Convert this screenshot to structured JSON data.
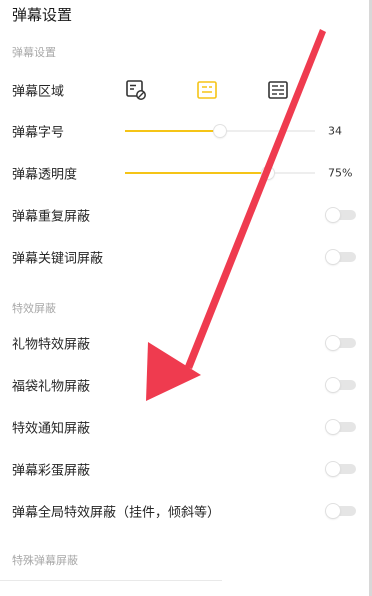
{
  "header": {
    "title": "弹幕设置"
  },
  "section_danmaku": {
    "label": "弹幕设置"
  },
  "area": {
    "label": "弹幕区域",
    "options": [
      {
        "icon": "screen-area-disabled-icon",
        "selected": false
      },
      {
        "icon": "half-screen-area-icon",
        "selected": true
      },
      {
        "icon": "full-screen-area-icon",
        "selected": false
      }
    ],
    "accent": "#f5c417"
  },
  "font_size": {
    "label": "弹幕字号",
    "value": "34",
    "fraction": 0.5
  },
  "opacity": {
    "label": "弹幕透明度",
    "value": "75%",
    "fraction": 0.75
  },
  "toggles_main": [
    {
      "label": "弹幕重复屏蔽",
      "on": false
    },
    {
      "label": "弹幕关键词屏蔽",
      "on": false
    }
  ],
  "section_effects": {
    "label": "特效屏蔽"
  },
  "toggles_effects": [
    {
      "label": "礼物特效屏蔽",
      "on": false
    },
    {
      "label": "福袋礼物屏蔽",
      "on": false
    },
    {
      "label": "特效通知屏蔽",
      "on": false
    },
    {
      "label": "弹幕彩蛋屏蔽",
      "on": false
    },
    {
      "label": "弹幕全局特效屏蔽（挂件，倾斜等）",
      "on": false
    }
  ],
  "section_special": {
    "label": "特殊弹幕屏蔽"
  },
  "colors": {
    "accent": "#f5c417",
    "arrow": "#ef3b4f"
  }
}
